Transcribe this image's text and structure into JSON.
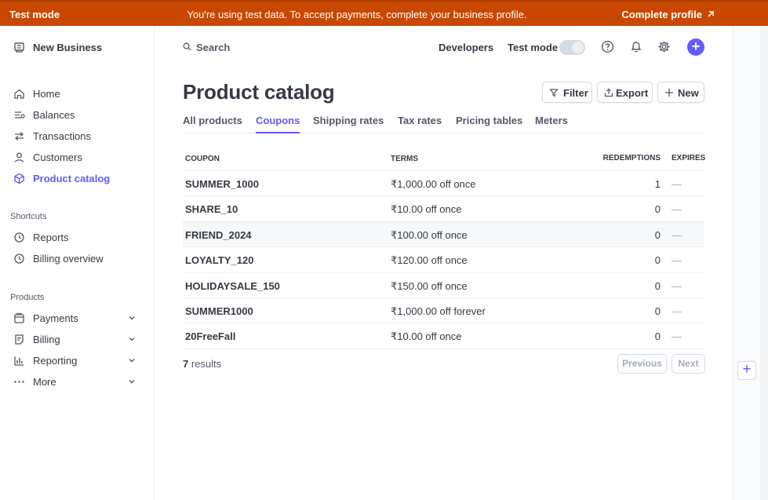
{
  "banner": {
    "mode_label": "Test mode",
    "message": "You're using test data. To accept payments, complete your business profile.",
    "cta": "Complete profile"
  },
  "sidebar": {
    "business_name": "New Business",
    "nav": [
      {
        "label": "Home",
        "icon": "home-icon"
      },
      {
        "label": "Balances",
        "icon": "balances-icon"
      },
      {
        "label": "Transactions",
        "icon": "transactions-icon"
      },
      {
        "label": "Customers",
        "icon": "customers-icon"
      },
      {
        "label": "Product catalog",
        "icon": "product-catalog-icon",
        "active": true
      }
    ],
    "shortcuts_title": "Shortcuts",
    "shortcuts": [
      {
        "label": "Reports",
        "icon": "clock-icon"
      },
      {
        "label": "Billing overview",
        "icon": "clock-icon"
      }
    ],
    "products_title": "Products",
    "products": [
      {
        "label": "Payments",
        "icon": "payments-icon"
      },
      {
        "label": "Billing",
        "icon": "billing-icon"
      },
      {
        "label": "Reporting",
        "icon": "reporting-icon"
      },
      {
        "label": "More",
        "icon": "more-icon"
      }
    ]
  },
  "topbar": {
    "search_label": "Search",
    "developers": "Developers",
    "test_mode": "Test mode"
  },
  "page": {
    "title": "Product catalog",
    "actions": {
      "filter": "Filter",
      "export": "Export",
      "new": "New"
    },
    "tabs": [
      "All products",
      "Coupons",
      "Shipping rates",
      "Tax rates",
      "Pricing tables",
      "Meters"
    ],
    "active_tab": "Coupons"
  },
  "table": {
    "columns": [
      "COUPON",
      "TERMS",
      "REDEMPTIONS",
      "EXPIRES"
    ],
    "rows": [
      {
        "coupon": "SUMMER_1000",
        "terms": "₹1,000.00 off once",
        "redemptions": "1",
        "expires": "—"
      },
      {
        "coupon": "SHARE_10",
        "terms": "₹10.00 off once",
        "redemptions": "0",
        "expires": "—"
      },
      {
        "coupon": "FRIEND_2024",
        "terms": "₹100.00 off once",
        "redemptions": "0",
        "expires": "—"
      },
      {
        "coupon": "LOYALTY_120",
        "terms": "₹120.00 off once",
        "redemptions": "0",
        "expires": "—"
      },
      {
        "coupon": "HOLIDAYSALE_150",
        "terms": "₹150.00 off once",
        "redemptions": "0",
        "expires": "—"
      },
      {
        "coupon": "SUMMER1000",
        "terms": "₹1,000.00 off forever",
        "redemptions": "0",
        "expires": "—"
      },
      {
        "coupon": "20FreeFall",
        "terms": "₹10.00 off once",
        "redemptions": "0",
        "expires": "—"
      }
    ]
  },
  "footer": {
    "results_count": "7",
    "results_label": "results",
    "previous": "Previous",
    "next": "Next"
  },
  "colors": {
    "accent": "#635bff",
    "banner": "#c84801"
  }
}
